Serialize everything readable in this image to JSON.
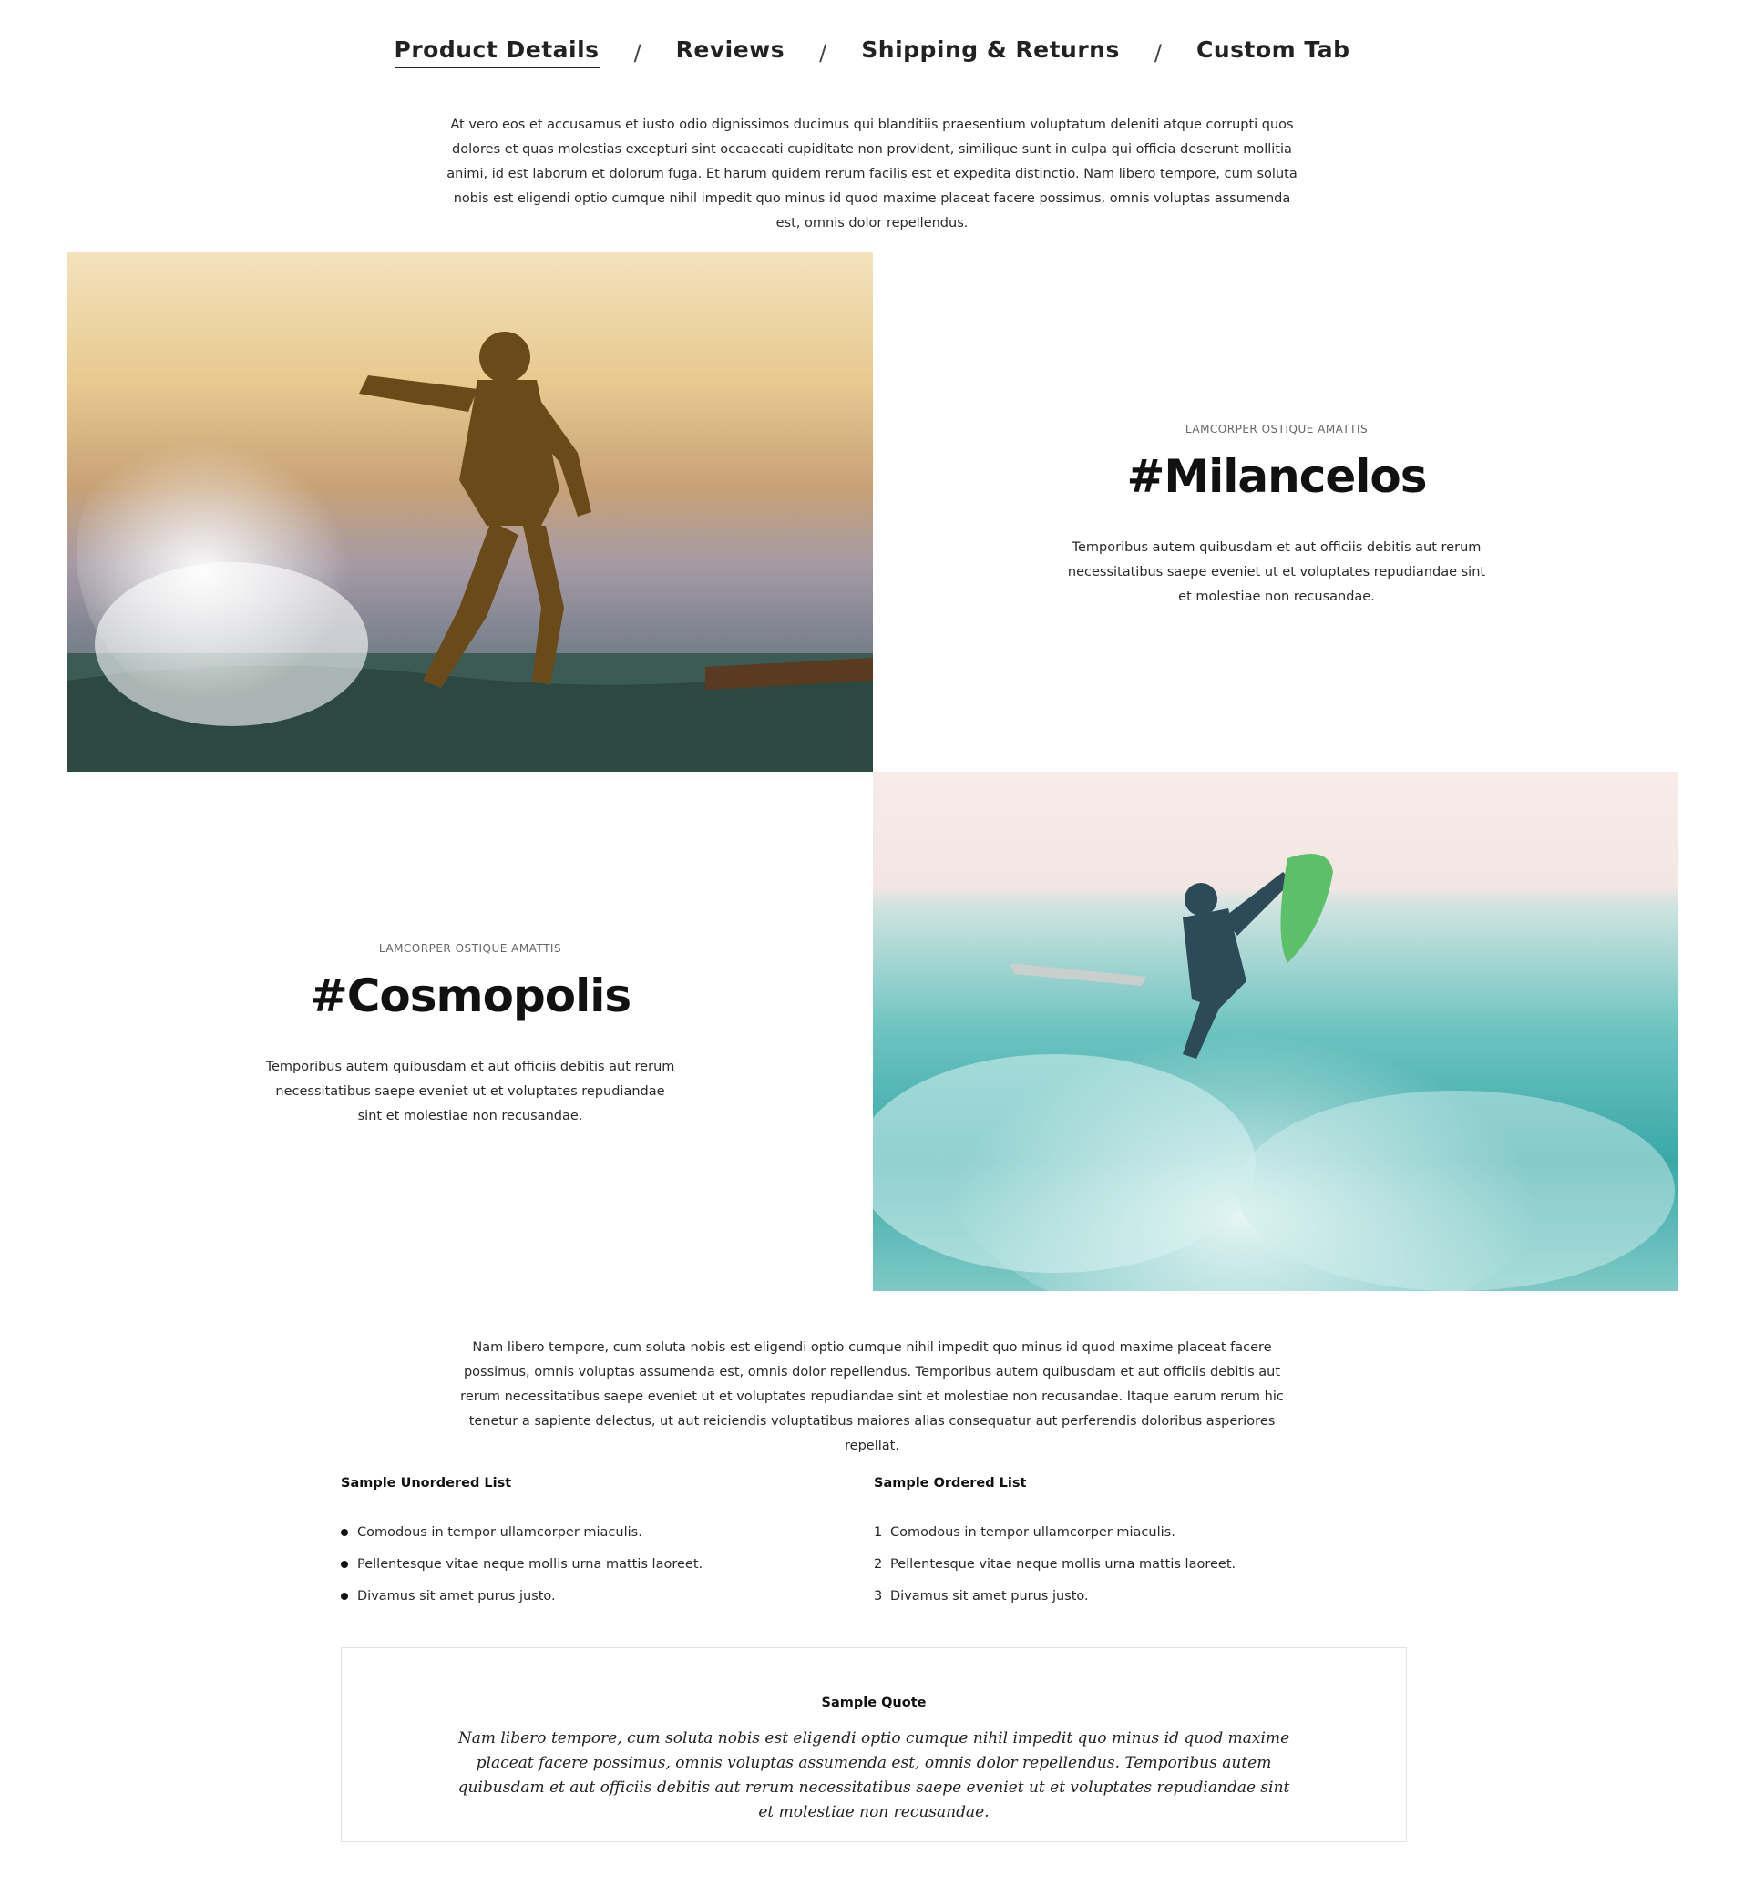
{
  "tabs": [
    {
      "label": "Product Details",
      "active": true
    },
    {
      "label": "Reviews",
      "active": false
    },
    {
      "label": "Shipping & Returns",
      "active": false
    },
    {
      "label": "Custom Tab",
      "active": false
    }
  ],
  "tab_separator": "/",
  "intro_text": "At vero eos et accusamus et iusto odio dignissimos ducimus qui blanditiis praesentium voluptatum deleniti atque corrupti quos dolores et quas molestias excepturi sint occaecati cupiditate non provident, similique sunt in culpa qui officia deserunt mollitia animi, id est laborum et dolorum fuga. Et harum quidem rerum facilis est et expedita distinctio. Nam libero tempore, cum soluta nobis est eligendi optio cumque nihil impedit quo minus id quod maxime placeat facere possimus, omnis voluptas assumenda est, omnis dolor repellendus.",
  "features": [
    {
      "kicker": "LAMCORPER OSTIQUE AMATTIS",
      "heading": "#Milancelos",
      "description": "Temporibus autem quibusdam et aut officiis debitis aut rerum necessitatibus saepe eveniet ut et voluptates repudiandae sint et molestiae non recusandae."
    },
    {
      "kicker": "LAMCORPER OSTIQUE AMATTIS",
      "heading": "#Cosmopolis",
      "description": "Temporibus autem quibusdam et aut officiis debitis aut rerum necessitatibus saepe eveniet ut et voluptates repudiandae sint et molestiae non recusandae."
    }
  ],
  "outro_text": "Nam libero tempore, cum soluta nobis est eligendi optio cumque nihil impedit quo minus id quod maxime placeat facere possimus, omnis voluptas assumenda est, omnis dolor repellendus. Temporibus autem quibusdam et aut officiis debitis aut rerum necessitatibus saepe eveniet ut et voluptates repudiandae sint et molestiae non recusandae. Itaque earum rerum hic tenetur a sapiente delectus, ut aut reiciendis voluptatibus maiores alias consequatur aut perferendis doloribus asperiores repellat.",
  "unordered_list": {
    "title": "Sample Unordered List",
    "items": [
      "Comodous in tempor ullamcorper miaculis.",
      "Pellentesque vitae neque mollis urna mattis laoreet.",
      "Divamus sit amet purus justo."
    ]
  },
  "ordered_list": {
    "title": "Sample Ordered List",
    "items": [
      {
        "num": "1",
        "text": "Comodous in tempor ullamcorper miaculis."
      },
      {
        "num": "2",
        "text": "Pellentesque vitae neque mollis urna mattis laoreet."
      },
      {
        "num": "3",
        "text": "Divamus sit amet purus justo."
      }
    ]
  },
  "quote": {
    "title": "Sample Quote",
    "text": "Nam libero tempore, cum soluta nobis est eligendi optio cumque nihil impedit quo minus id quod maxime placeat facere possimus, omnis voluptas assumenda est, omnis dolor repellendus. Temporibus autem quibusdam et aut officiis debitis aut rerum necessitatibus saepe eveniet ut et voluptates repudiandae sint et molestiae non recusandae."
  }
}
